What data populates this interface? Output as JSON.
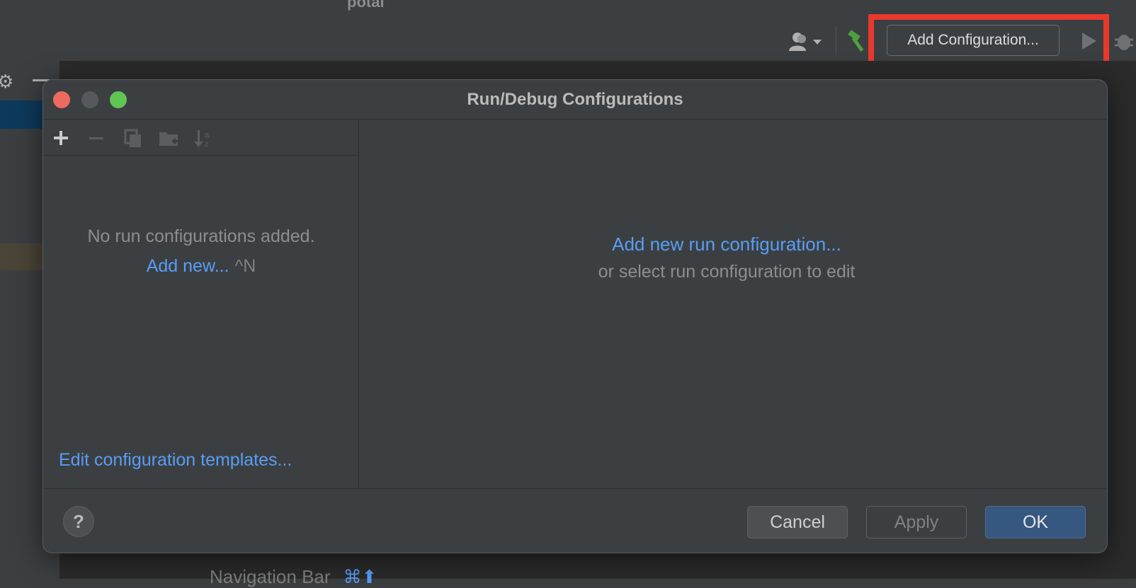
{
  "ide": {
    "project_name": "potal",
    "toolbar": {
      "add_configuration_label": "Add Configuration..."
    },
    "nav_bar_hint": {
      "label": "Navigation Bar",
      "shortcut": "⌘⬆"
    }
  },
  "dialog": {
    "title": "Run/Debug Configurations",
    "left_pane": {
      "empty_message": "No run configurations added.",
      "add_new_link": "Add new...",
      "add_new_shortcut": "^N",
      "edit_templates_link": "Edit configuration templates..."
    },
    "right_pane": {
      "add_new_link": "Add new run configuration...",
      "hint": "or select run configuration to edit"
    },
    "buttons": {
      "help": "?",
      "cancel": "Cancel",
      "apply": "Apply",
      "ok": "OK"
    }
  },
  "colors": {
    "link": "#589df6",
    "highlight_box": "#e8392c",
    "ok_button": "#365880",
    "traffic_close": "#ec6a5f",
    "traffic_maximize": "#61c554"
  },
  "icons": [
    "user-icon",
    "hammer-icon",
    "run-icon",
    "debug-icon",
    "gear-icon",
    "add-icon",
    "remove-icon",
    "copy-icon",
    "folder-add-icon",
    "sort-icon"
  ]
}
